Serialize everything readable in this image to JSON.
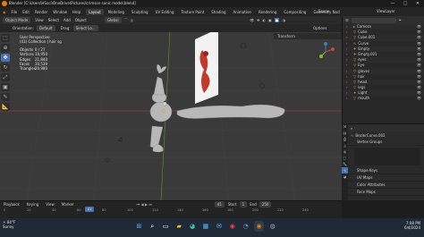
{
  "titlebar": {
    "title": "Blender [C:\\Users\\HSoci\\OneDrive\\Pictures\\crimson sonic model.blend]",
    "minimize": "—",
    "maximize": "□",
    "close": "✕"
  },
  "menu": {
    "items": [
      "File",
      "Edit",
      "Render",
      "Window",
      "Help"
    ],
    "workspaces": [
      "Layout",
      "Modeling",
      "Sculpting",
      "UV Editing",
      "Texture Paint",
      "Shading",
      "Animation",
      "Rendering",
      "Compositing",
      "Geometry Nod"
    ],
    "scene": "Scene",
    "view_layer": "ViewLayer"
  },
  "viewport_header": {
    "mode": "Object Mode",
    "view": "View",
    "select": "Select",
    "add": "Add",
    "object": "Object",
    "transform": "Global",
    "orientation_label": "Orientation:",
    "orientation_value": "Default",
    "drag_label": "Drag:",
    "drag_value": "Select Lo...",
    "options": "Options"
  },
  "overlay_text": {
    "view_name": "User Perspective",
    "collection": "(41) Collection | hair sg",
    "stats": [
      {
        "k": "Objects",
        "v": "0 / 27"
      },
      {
        "k": "Vertices",
        "v": "10,950"
      },
      {
        "k": "Edges",
        "v": "21,840"
      },
      {
        "k": "Faces",
        "v": "10,539"
      },
      {
        "k": "Triangles",
        "v": "20,980"
      }
    ],
    "transform_panel": "Transform"
  },
  "outliner": {
    "search_placeholder": "",
    "items": [
      {
        "name": "Camera",
        "icon": "camera-icon"
      },
      {
        "name": "Cube",
        "icon": "mesh-icon"
      },
      {
        "name": "Cube.001",
        "icon": "mesh-icon"
      },
      {
        "name": "Curve",
        "icon": "curve-icon"
      },
      {
        "name": "Empty",
        "icon": "empty-icon"
      },
      {
        "name": "Empty.001",
        "icon": "empty-icon"
      },
      {
        "name": "eyes",
        "icon": "mesh-icon"
      },
      {
        "name": "Eye",
        "icon": "mesh-icon"
      },
      {
        "name": "gloves",
        "icon": "mesh-icon"
      },
      {
        "name": "hair",
        "icon": "mesh-icon"
      },
      {
        "name": "head",
        "icon": "mesh-icon"
      },
      {
        "name": "legs",
        "icon": "mesh-icon"
      },
      {
        "name": "Light",
        "icon": "light-icon"
      },
      {
        "name": "mouth",
        "icon": "mesh-icon"
      }
    ]
  },
  "properties": {
    "object_name": "BezierCurve.002",
    "sections": [
      "Vertex Groups",
      "Shape Keys",
      "UV Maps",
      "Color Attributes",
      "Face Maps"
    ]
  },
  "timeline": {
    "playback": "Playback",
    "keying": "Keying",
    "view": "View",
    "marker": "Marker",
    "current_frame": "41",
    "start_label": "Start",
    "start": "1",
    "end_label": "End",
    "end": "250",
    "ticks": [
      "0",
      "20",
      "40",
      "60",
      "80",
      "100",
      "120",
      "140",
      "160",
      "180",
      "200",
      "220",
      "240"
    ]
  },
  "taskbar": {
    "weather_temp": "84°F",
    "weather_desc": "Sunny",
    "time": "7:08 PM",
    "date": "6/4/2024"
  },
  "colors": {
    "accent": "#4772b3",
    "viewport_bg": "#3a3a3a",
    "grid_red": "#9b3b3b",
    "grid_green": "#6c8f2c"
  }
}
